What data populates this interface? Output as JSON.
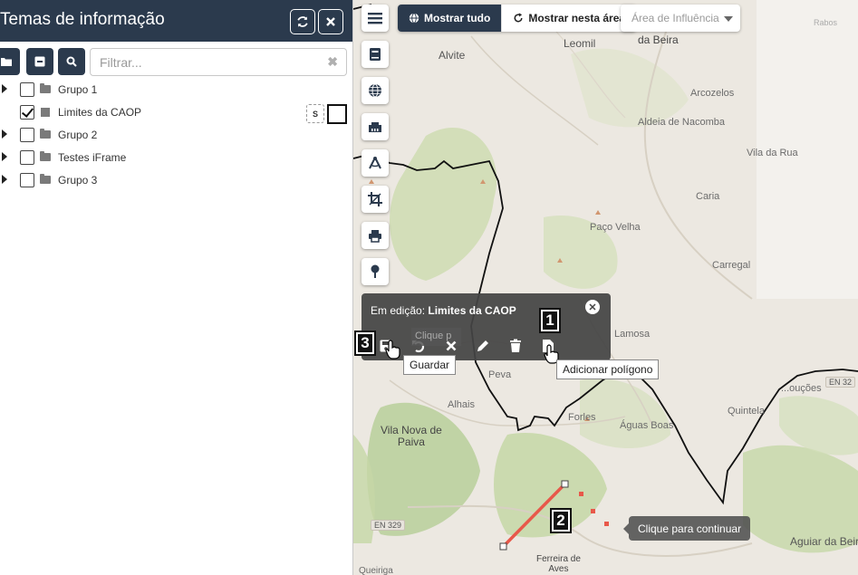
{
  "panel": {
    "title": "Temas de informação",
    "filter_placeholder": "Filtrar...",
    "tree": [
      {
        "label": "Grupo 1",
        "type": "group",
        "checked": false
      },
      {
        "label": "Limites da CAOP",
        "type": "layer",
        "checked": true,
        "style_button": "S"
      },
      {
        "label": "Grupo 2",
        "type": "group",
        "checked": false
      },
      {
        "label": "Testes iFrame",
        "type": "group",
        "checked": false
      },
      {
        "label": "Grupo 3",
        "type": "group",
        "checked": false
      }
    ]
  },
  "toolbar_top": {
    "show_all": "Mostrar tudo",
    "show_area": "Mostrar nesta área",
    "area_select": "Área de Influência"
  },
  "edit_popup": {
    "prefix": "Em edição: ",
    "layer": "Limites da CAOP",
    "obscured_text": "Clique p"
  },
  "tooltips": {
    "save": "Guardar",
    "add_polygon": "Adicionar polígono",
    "continue": "Clique para continuar"
  },
  "badges": {
    "one": "1",
    "two": "2",
    "three": "3"
  },
  "map_labels": {
    "moimenta": "Moimenta\nda Beira",
    "leomil": "Leomil",
    "alvite": "Alvite",
    "arcozelos": "Arcozelos",
    "aldeia_nacomba": "Aldeia de Nacomba",
    "vila_da_rua": "Vila da Rua",
    "caria": "Caria",
    "paco_velha": "Paço Velha",
    "carregal": "Carregal",
    "lamosa": "Lamosa",
    "peva": "Peva",
    "alhais": "Alhais",
    "forles": "Forles",
    "aguas_boas": "Águas Boas",
    "quintela": "Quintela",
    "soucoes": "...ouções",
    "vila_nova_paiva": "Vila Nova de\nPaiva",
    "en329": "EN 329",
    "en323": "EN 32",
    "ferreira_aves": "Ferreira de\nAves",
    "aguiar_beira": "Aguiar da Beira",
    "queiriga": "Queiriga",
    "rabos": "Rabos"
  },
  "colors": {
    "panel_dark": "#2b3a4d",
    "map_bg": "#ece8e1",
    "forest": "#cfdcb2",
    "boundary": "#111111",
    "drawing_line": "#e8584a"
  }
}
